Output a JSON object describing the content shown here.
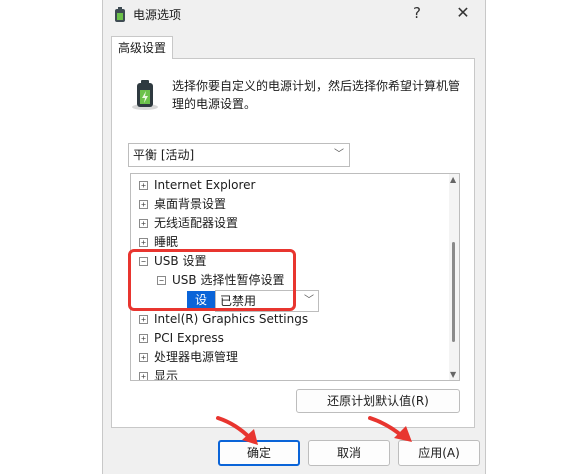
{
  "window": {
    "title": "电源选项",
    "help_glyph": "?",
    "close_glyph": "✕"
  },
  "tab": {
    "label": "高级设置"
  },
  "description": "选择你要自定义的电源计划，然后选择你希望计算机管理的电源设置。",
  "plan_select": {
    "value": "平衡 [活动]"
  },
  "tree": {
    "items": [
      {
        "label": "Internet Explorer",
        "expander": "+"
      },
      {
        "label": "桌面背景设置",
        "expander": "+"
      },
      {
        "label": "无线适配器设置",
        "expander": "+"
      },
      {
        "label": "睡眠",
        "expander": "+"
      },
      {
        "label": "USB 设置",
        "expander": "−"
      },
      {
        "label": "USB 选择性暂停设置",
        "expander": "−"
      },
      {
        "label": "Intel(R) Graphics Settings",
        "expander": "+"
      },
      {
        "label": "PCI Express",
        "expander": "+"
      },
      {
        "label": "处理器电源管理",
        "expander": "+"
      },
      {
        "label": "显示",
        "expander": "+"
      }
    ],
    "setting_label": "设置:",
    "setting_value": "已禁用"
  },
  "buttons": {
    "restore": "还原计划默认值(R)",
    "ok": "确定",
    "cancel": "取消",
    "apply": "应用(A)"
  },
  "icons": {
    "title": "power-battery-icon",
    "panel": "power-battery-icon"
  },
  "colors": {
    "accent": "#0a64d8",
    "highlight": "#e8352f"
  }
}
